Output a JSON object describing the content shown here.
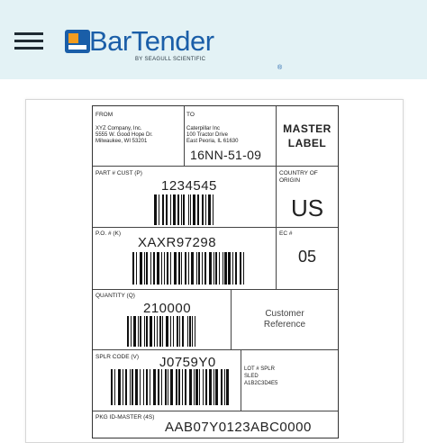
{
  "header": {
    "menu_icon": "hamburger-menu-icon",
    "brand": "BarTender",
    "brand_reg": "®",
    "brand_sub": "BY SEAGULL SCIENTIFIC",
    "colors": {
      "background": "#e3f2f5",
      "brand_blue": "#1a5ea8",
      "brand_orange": "#f39c1f"
    }
  },
  "label": {
    "from_caption": "FROM",
    "from_lines": [
      "XYZ Company, Inc.",
      "5555 W. Good Hope Dr.",
      "Milwaukee, WI 53201"
    ],
    "to_caption": "TO",
    "to_lines": [
      "Caterpillar Inc",
      "100 Tractor Drive",
      "East Peoria, IL 61630"
    ],
    "to_code": "16NN-51-09",
    "master_line1": "MASTER",
    "master_line2": "LABEL",
    "part_caption": "PART # CUST (P)",
    "part_value": "1234545",
    "country_caption_1": "COUNTRY OF",
    "country_caption_2": "ORIGIN",
    "country_value": "US",
    "po_caption": "P.O. # (K)",
    "po_value": "XAXR97298",
    "ec_caption": "EC #",
    "ec_value": "05",
    "qty_caption": "QUANTITY (Q)",
    "qty_value": "210000",
    "customer_ref_1": "Customer",
    "customer_ref_2": "Reference",
    "splr_caption": "SPLR CODE (V)",
    "splr_value": "J0759Y0",
    "lot_caption": "LOT # SPLR",
    "lot_line2": "SLED",
    "lot_line3": "A1B2C3D4E5",
    "pkg_caption": "PKG ID-MASTER (4S)",
    "pkg_value": "AAB07Y0123ABC0000"
  }
}
